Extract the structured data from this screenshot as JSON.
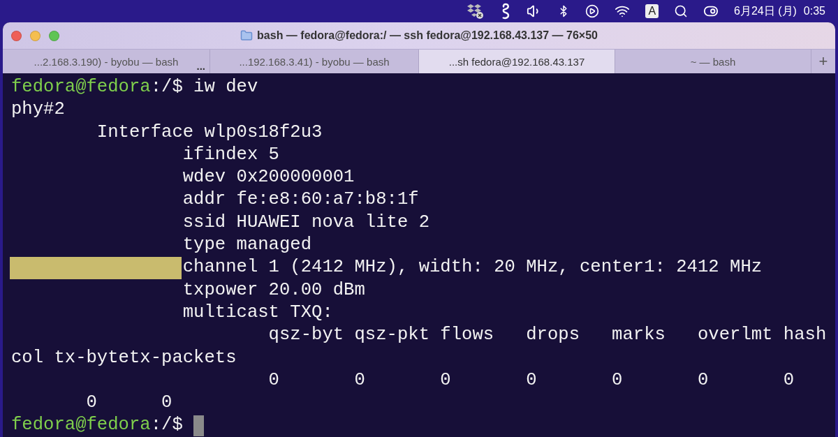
{
  "menu_bar": {
    "input_badge": "A",
    "date": "6月24日 (月)",
    "time": "0:35"
  },
  "window": {
    "title": "bash — fedora@fedora:/ — ssh fedora@192.168.43.137 — 76×50"
  },
  "tabs": [
    {
      "label": "...2.168.3.190) - byobu — bash",
      "selected": false,
      "overflow_marker": "..."
    },
    {
      "label": "...192.168.3.41) - byobu — bash",
      "selected": false
    },
    {
      "label": "...sh fedora@192.168.43.137",
      "selected": true
    },
    {
      "label": "~ — bash",
      "selected": false
    }
  ],
  "new_tab": "+",
  "terminal": {
    "lines": [
      {
        "segments": [
          {
            "kind": "user",
            "text": "fedora@fedora"
          },
          {
            "kind": "plain",
            "text": ":/$ iw dev"
          }
        ]
      },
      {
        "segments": [
          {
            "kind": "plain",
            "text": "phy#2"
          }
        ]
      },
      {
        "segments": [
          {
            "kind": "plain",
            "text": "        Interface wlp0s18f2u3"
          }
        ]
      },
      {
        "segments": [
          {
            "kind": "plain",
            "text": "                ifindex 5"
          }
        ]
      },
      {
        "segments": [
          {
            "kind": "plain",
            "text": "                wdev 0x200000001"
          }
        ]
      },
      {
        "segments": [
          {
            "kind": "plain",
            "text": "                addr fe:e8:60:a7:b8:1f"
          }
        ]
      },
      {
        "segments": [
          {
            "kind": "plain",
            "text": "                ssid HUAWEI nova lite 2"
          }
        ]
      },
      {
        "segments": [
          {
            "kind": "plain",
            "text": "                type managed"
          }
        ]
      },
      {
        "marked": true,
        "segments": [
          {
            "kind": "plain",
            "text": "channel 1 (2412 MHz), width: 20 MHz, center1: 2412 MHz"
          }
        ]
      },
      {
        "segments": [
          {
            "kind": "plain",
            "text": "                txpower 20.00 dBm"
          }
        ]
      },
      {
        "segments": [
          {
            "kind": "plain",
            "text": "                multicast TXQ:"
          }
        ]
      },
      {
        "segments": [
          {
            "kind": "plain",
            "text": "                        qsz-byt qsz-pkt flows   drops   marks   overlmt hash"
          }
        ]
      },
      {
        "segments": [
          {
            "kind": "plain",
            "text": "col tx-bytetx-packets"
          }
        ]
      },
      {
        "segments": [
          {
            "kind": "plain",
            "text": "                        0       0       0       0       0       0       0"
          }
        ]
      },
      {
        "segments": [
          {
            "kind": "plain",
            "text": "       0      0"
          }
        ]
      },
      {
        "segments": [
          {
            "kind": "user",
            "text": "fedora@fedora"
          },
          {
            "kind": "plain",
            "text": ":/$ "
          }
        ],
        "cursor": true
      }
    ]
  }
}
